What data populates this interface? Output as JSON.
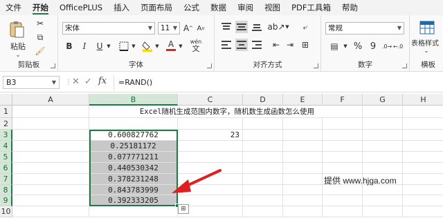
{
  "menu": {
    "items": [
      "文件",
      "开始",
      "OfficePLUS",
      "插入",
      "页面布局",
      "公式",
      "数据",
      "审阅",
      "视图",
      "PDF工具箱",
      "帮助"
    ],
    "active_index": 1
  },
  "ribbon": {
    "clipboard": {
      "label": "剪贴板",
      "paste": "粘贴"
    },
    "font": {
      "label": "字体",
      "font_name": "宋体",
      "font_size": "11",
      "bold": "B",
      "italic": "I",
      "underline": "U",
      "grow": "A",
      "shrink": "A",
      "color_a": "A",
      "phonetic_top": "wén",
      "phonetic_bottom": "文"
    },
    "alignment": {
      "label": "对齐方式"
    },
    "number": {
      "label": "数字",
      "format": "常规",
      "percent": "%",
      "comma": "9"
    },
    "table_format": {
      "label": "表格样式",
      "group_label": "横板"
    }
  },
  "formula_bar": {
    "name_box": "B3",
    "fx": "fx",
    "formula": "=RAND()"
  },
  "grid": {
    "columns": [
      "A",
      "B",
      "C",
      "D",
      "E",
      "F",
      "G",
      "H"
    ],
    "rows": [
      "1",
      "2",
      "3",
      "4",
      "5",
      "6",
      "7",
      "8",
      "9",
      "10"
    ],
    "selected_column": "B",
    "selected_rows": [
      "3",
      "4",
      "5",
      "6",
      "7",
      "8",
      "9"
    ],
    "title": "Excel随机生成范围内数字，随机数生成函数怎么使用",
    "b_values": [
      "0.600827762",
      "0.25181172",
      "0.077771211",
      "0.440530342",
      "0.378231248",
      "0.843783999",
      "0.392333205"
    ],
    "c3": "23",
    "watermark": "提供 www.hjga.com"
  },
  "colors": {
    "accent": "#1e7a45",
    "arrow": "#e02020",
    "selected_fill": "#c8c8c8"
  }
}
